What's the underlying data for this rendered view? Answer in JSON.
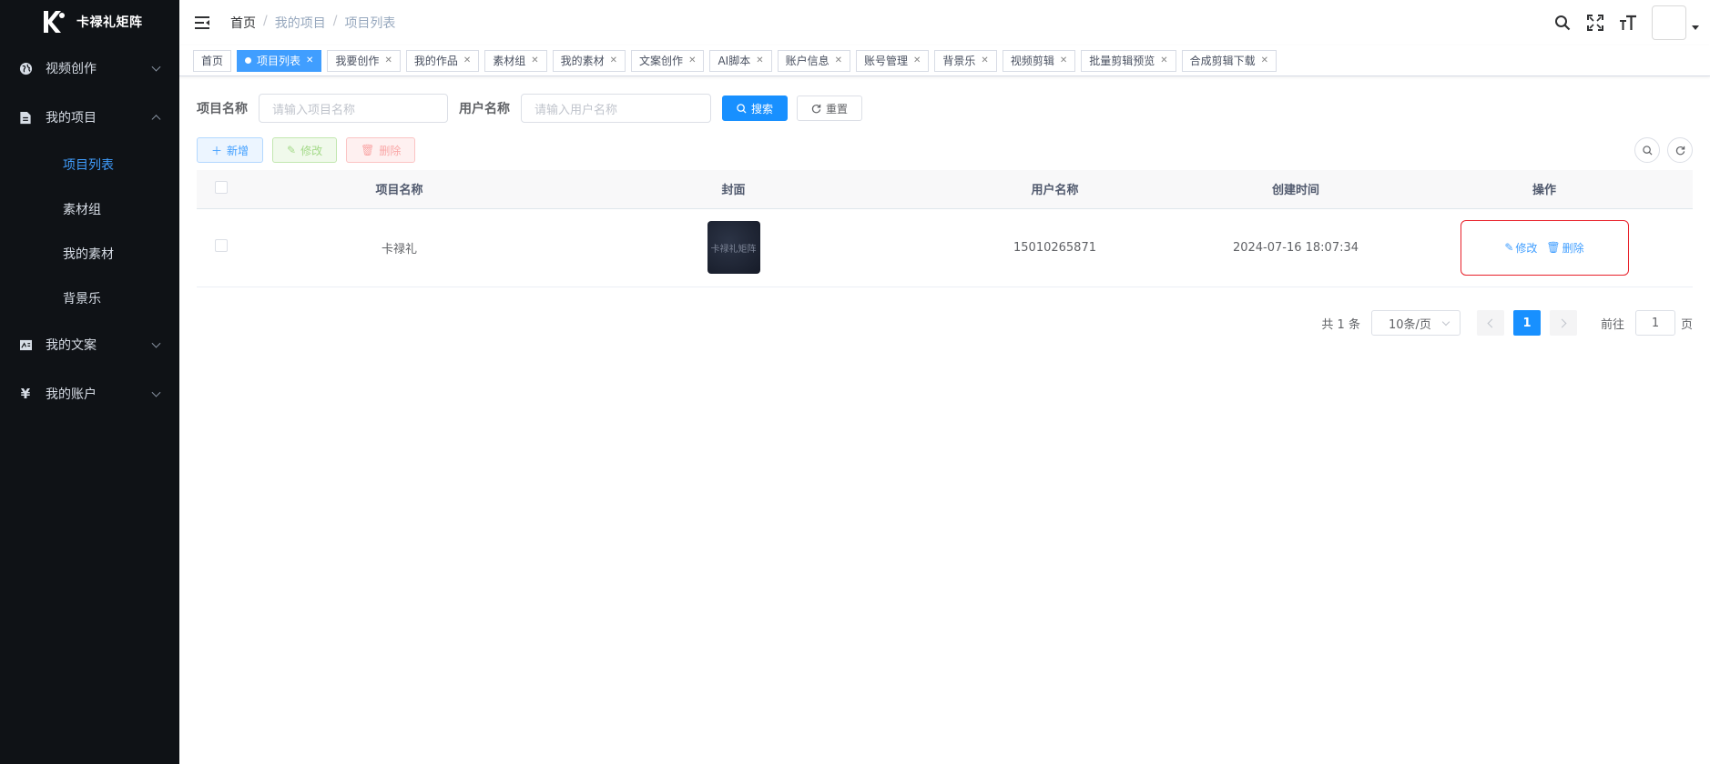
{
  "app": {
    "name": "卡禄礼矩阵"
  },
  "sidebar": {
    "items": [
      {
        "label": "视频创作",
        "icon": "globe-icon"
      },
      {
        "label": "我的项目",
        "icon": "document-icon"
      },
      {
        "label": "我的文案",
        "icon": "image-text-icon"
      },
      {
        "label": "我的账户",
        "icon": "yen-icon"
      }
    ],
    "sub": [
      {
        "label": "项目列表",
        "active": true
      },
      {
        "label": "素材组"
      },
      {
        "label": "我的素材"
      },
      {
        "label": "背景乐"
      }
    ]
  },
  "breadcrumb": {
    "home": "首页",
    "level1": "我的项目",
    "level2": "项目列表",
    "sep": "/"
  },
  "tags": [
    {
      "label": "首页"
    },
    {
      "label": "项目列表",
      "active": true
    },
    {
      "label": "我要创作"
    },
    {
      "label": "我的作品"
    },
    {
      "label": "素材组"
    },
    {
      "label": "我的素材"
    },
    {
      "label": "文案创作"
    },
    {
      "label": "AI脚本"
    },
    {
      "label": "账户信息"
    },
    {
      "label": "账号管理"
    },
    {
      "label": "背景乐"
    },
    {
      "label": "视频剪辑"
    },
    {
      "label": "批量剪辑预览"
    },
    {
      "label": "合成剪辑下载"
    }
  ],
  "search": {
    "project_label": "项目名称",
    "project_placeholder": "请输入项目名称",
    "user_label": "用户名称",
    "user_placeholder": "请输入用户名称",
    "search_btn": "搜索",
    "reset_btn": "重置"
  },
  "toolbar": {
    "add": "新增",
    "edit": "修改",
    "delete": "删除"
  },
  "table": {
    "headers": {
      "name": "项目名称",
      "cover": "封面",
      "user": "用户名称",
      "created": "创建时间",
      "ops": "操作"
    },
    "rows": [
      {
        "name": "卡禄礼",
        "cover_text": "卡禄礼矩阵",
        "user": "15010265871",
        "created": "2024-07-16 18:07:34",
        "edit": "修改",
        "delete": "删除"
      }
    ]
  },
  "pagination": {
    "total": "共 1 条",
    "page_size": "10条/页",
    "current": "1",
    "goto_label": "前往",
    "goto_value": "1",
    "page_suffix": "页"
  },
  "colors": {
    "primary": "#1890ff",
    "sidebar_bg": "#0f1216",
    "highlight_border": "#e8202a"
  }
}
